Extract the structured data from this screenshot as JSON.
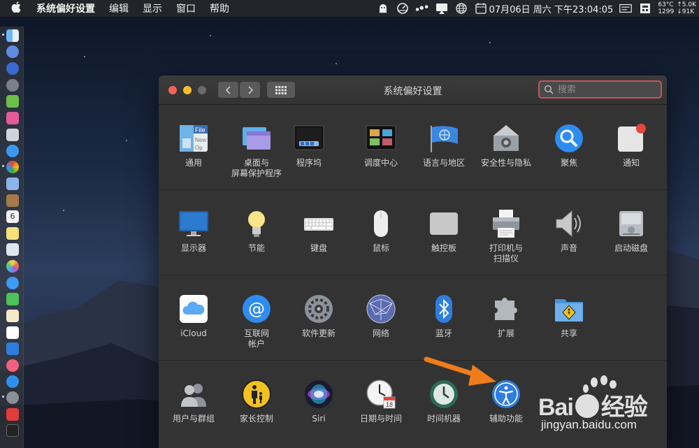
{
  "menubar": {
    "app_name": "系统偏好设置",
    "menus": [
      "编辑",
      "显示",
      "窗口",
      "帮助"
    ],
    "status": {
      "datetime": "07月06日 周六 下午23:04:05",
      "temp": "63°C",
      "up": "↑5.0K",
      "mem": "1299",
      "down": "↓91K"
    }
  },
  "window": {
    "title": "系统偏好设置",
    "search_placeholder": "搜索",
    "colors": {
      "close": "#fe5f57",
      "minimize": "#febc2e",
      "zoom": "#6b6b6b",
      "search_ring": "#c0575a"
    }
  },
  "sections": [
    {
      "items": [
        {
          "label": "通用",
          "icon": "general-icon"
        },
        {
          "label": "桌面与\n屏幕保护程序",
          "icon": "desktop-screensaver-icon"
        },
        {
          "label": "程序坞",
          "icon": "dock-icon"
        },
        {
          "label": "调度中心",
          "icon": "mission-control-icon"
        },
        {
          "label": "语言与地区",
          "icon": "language-region-icon"
        },
        {
          "label": "安全性与隐私",
          "icon": "security-privacy-icon"
        },
        {
          "label": "聚焦",
          "icon": "spotlight-icon"
        },
        {
          "label": "通知",
          "icon": "notifications-icon"
        }
      ]
    },
    {
      "items": [
        {
          "label": "显示器",
          "icon": "displays-icon"
        },
        {
          "label": "节能",
          "icon": "energy-saver-icon"
        },
        {
          "label": "键盘",
          "icon": "keyboard-icon"
        },
        {
          "label": "鼠标",
          "icon": "mouse-icon"
        },
        {
          "label": "触控板",
          "icon": "trackpad-icon"
        },
        {
          "label": "打印机与\n扫描仪",
          "icon": "printer-scanner-icon"
        },
        {
          "label": "声音",
          "icon": "sound-icon"
        },
        {
          "label": "启动磁盘",
          "icon": "startup-disk-icon"
        }
      ]
    },
    {
      "items": [
        {
          "label": "iCloud",
          "icon": "icloud-icon"
        },
        {
          "label": "互联网\n帐户",
          "icon": "internet-accounts-icon"
        },
        {
          "label": "软件更新",
          "icon": "software-update-icon"
        },
        {
          "label": "网络",
          "icon": "network-icon"
        },
        {
          "label": "蓝牙",
          "icon": "bluetooth-icon"
        },
        {
          "label": "扩展",
          "icon": "extensions-icon"
        },
        {
          "label": "共享",
          "icon": "sharing-icon"
        }
      ]
    },
    {
      "items": [
        {
          "label": "用户与群组",
          "icon": "users-groups-icon"
        },
        {
          "label": "家长控制",
          "icon": "parental-controls-icon"
        },
        {
          "label": "Siri",
          "icon": "siri-icon"
        },
        {
          "label": "日期与时间",
          "icon": "date-time-icon"
        },
        {
          "label": "时间机器",
          "icon": "time-machine-icon"
        },
        {
          "label": "辅助功能",
          "icon": "accessibility-icon"
        }
      ]
    }
  ],
  "calendar_day": "18",
  "dock_date": "6",
  "watermark": {
    "brand": "Bai",
    "brand_cn": "经验",
    "url": "jingyan.baidu.com"
  }
}
